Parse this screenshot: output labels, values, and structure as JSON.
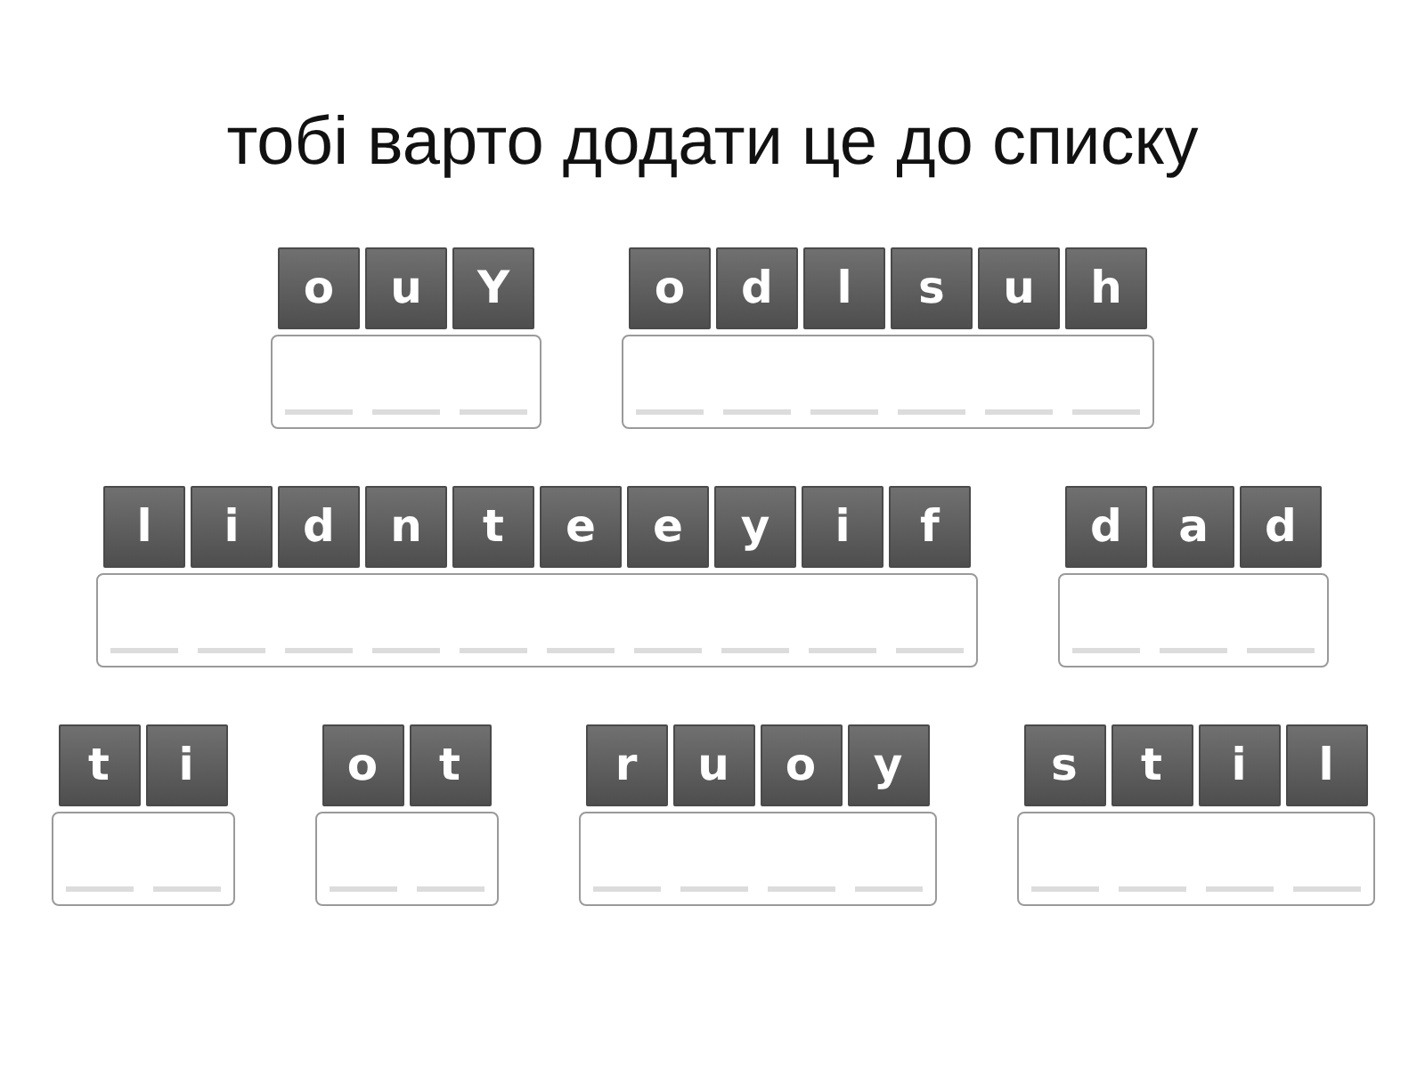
{
  "title": "тобі варто додати це до списку",
  "words": [
    {
      "tiles": [
        "o",
        "u",
        "Y"
      ]
    },
    {
      "tiles": [
        "o",
        "d",
        "l",
        "s",
        "u",
        "h"
      ]
    },
    {
      "tiles": [
        "l",
        "i",
        "d",
        "n",
        "t",
        "e",
        "e",
        "y",
        "i",
        "f"
      ]
    },
    {
      "tiles": [
        "d",
        "a",
        "d"
      ]
    },
    {
      "tiles": [
        "t",
        "i"
      ]
    },
    {
      "tiles": [
        "o",
        "t"
      ]
    },
    {
      "tiles": [
        "r",
        "u",
        "o",
        "y"
      ]
    },
    {
      "tiles": [
        "s",
        "t",
        "i",
        "l"
      ]
    }
  ]
}
